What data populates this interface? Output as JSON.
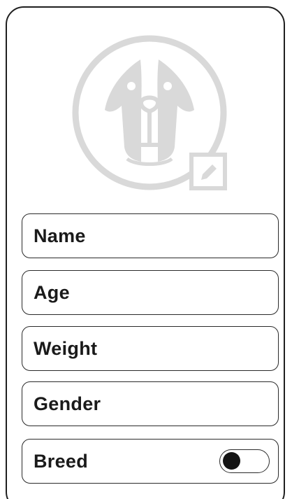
{
  "avatar": {
    "icon": "dog-avatar-icon",
    "edit_icon": "pencil-icon",
    "color": "#d9d9d9"
  },
  "form": {
    "fields": [
      {
        "label": "Name"
      },
      {
        "label": "Age"
      },
      {
        "label": "Weight"
      },
      {
        "label": "Gender"
      },
      {
        "label": "Breed"
      }
    ],
    "breed_toggle_on": false
  }
}
